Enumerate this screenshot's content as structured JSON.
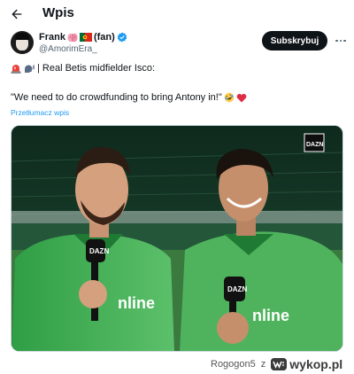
{
  "header": {
    "title": "Wpis",
    "back_icon": "arrow-left-icon"
  },
  "author": {
    "name": "Frank",
    "name_suffix": "(fan)",
    "handle": "@AmorimEra_",
    "verified_color": "#1d9bf0"
  },
  "subscribe_label": "Subskrybuj",
  "tweet": {
    "line1": "| Real Betis midfielder Isco:",
    "line2": "\"We need to do crowdfunding to bring Antony in!\"",
    "translate_label": "Przetłumacz wpis"
  },
  "media": {
    "broadcaster": "DAZN",
    "sponsor_text": "nline",
    "sponsor_text_2": "nline"
  },
  "watermark": {
    "user": "Rogogon5",
    "separator": "z",
    "site": "wykop.pl"
  },
  "colors": {
    "accent": "#1d9bf0",
    "dark": "#0f1419",
    "muted": "#536471",
    "heart": "#e0245e"
  }
}
